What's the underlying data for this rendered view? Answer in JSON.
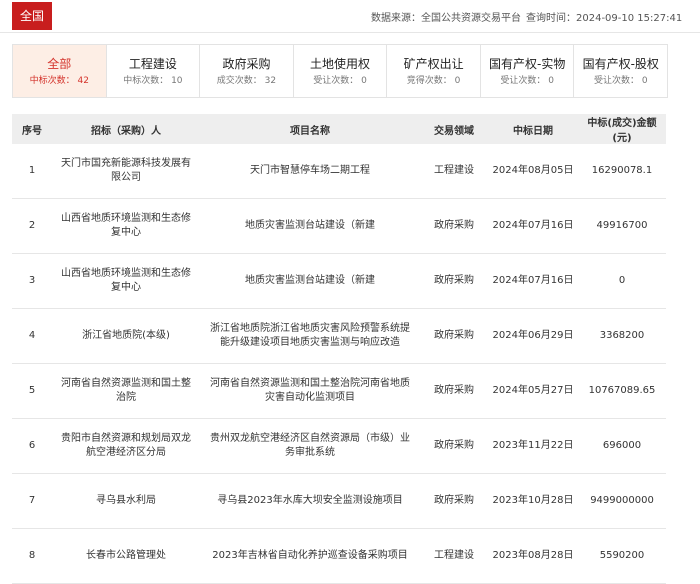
{
  "header": {
    "region_label": "全国",
    "source_label": "数据来源：",
    "source_value": "全国公共资源交易平台",
    "time_label": "查询时间：",
    "time_value": "2024-09-10 15:27:41"
  },
  "tabs": [
    {
      "name": "全部",
      "count_label": "中标次数：",
      "count": "42"
    },
    {
      "name": "工程建设",
      "count_label": "中标次数：",
      "count": "10"
    },
    {
      "name": "政府采购",
      "count_label": "成交次数：",
      "count": "32"
    },
    {
      "name": "土地使用权",
      "count_label": "受让次数：",
      "count": "0"
    },
    {
      "name": "矿产权出让",
      "count_label": "竞得次数：",
      "count": "0"
    },
    {
      "name": "国有产权-实物",
      "count_label": "受让次数：",
      "count": "0"
    },
    {
      "name": "国有产权-股权",
      "count_label": "受让次数：",
      "count": "0"
    }
  ],
  "table": {
    "columns": [
      "序号",
      "招标（采购）人",
      "项目名称",
      "交易领域",
      "中标日期",
      "中标(成交)金额(元)"
    ],
    "rows": [
      [
        "1",
        "天门市国充新能源科技发展有限公司",
        "天门市智慧停车场二期工程",
        "工程建设",
        "2024年08月05日",
        "16290078.1"
      ],
      [
        "2",
        "山西省地质环境监测和生态修复中心",
        "地质灾害监测台站建设（新建",
        "政府采购",
        "2024年07月16日",
        "49916700"
      ],
      [
        "3",
        "山西省地质环境监测和生态修复中心",
        "地质灾害监测台站建设（新建",
        "政府采购",
        "2024年07月16日",
        "0"
      ],
      [
        "4",
        "浙江省地质院(本级)",
        "浙江省地质院浙江省地质灾害风险预警系统提能升级建设项目地质灾害监测与响应改造",
        "政府采购",
        "2024年06月29日",
        "3368200"
      ],
      [
        "5",
        "河南省自然资源监测和国土整治院",
        "河南省自然资源监测和国土整治院河南省地质灾害自动化监测项目",
        "政府采购",
        "2024年05月27日",
        "10767089.65"
      ],
      [
        "6",
        "贵阳市自然资源和规划局双龙航空港经济区分局",
        "贵州双龙航空港经济区自然资源局（市级）业务审批系统",
        "政府采购",
        "2023年11月22日",
        "696000"
      ],
      [
        "7",
        "寻乌县水利局",
        "寻乌县2023年水库大坝安全监测设施项目",
        "政府采购",
        "2023年10月28日",
        "9499000000"
      ],
      [
        "8",
        "长春市公路管理处",
        "2023年吉林省自动化养护巡查设备采购项目",
        "工程建设",
        "2023年08月28日",
        "5590200"
      ]
    ]
  }
}
